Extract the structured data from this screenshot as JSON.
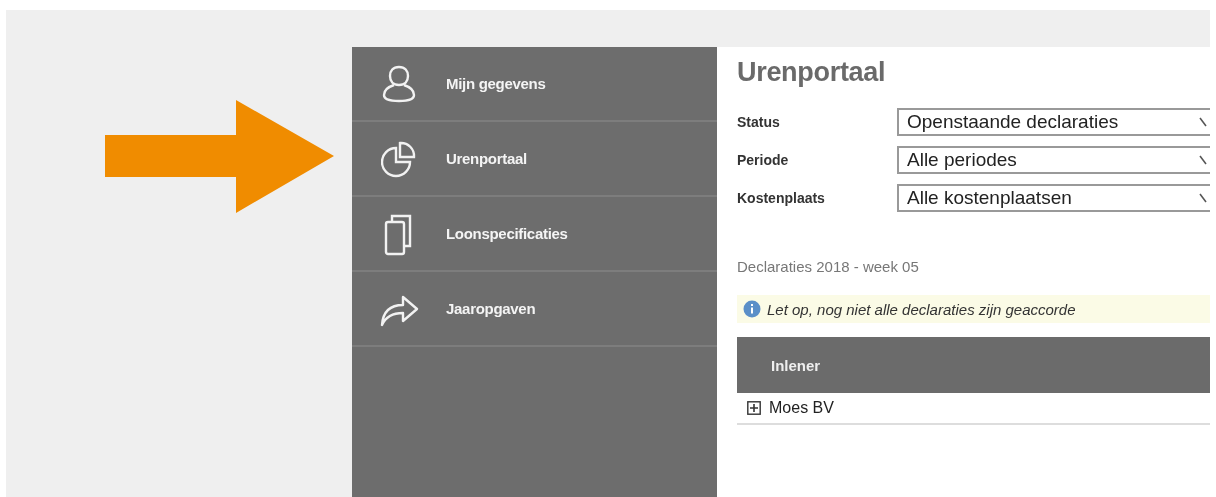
{
  "sidebar": {
    "items": [
      {
        "label": "Mijn gegevens",
        "kind": "person"
      },
      {
        "label": "Urenportaal",
        "kind": "chart"
      },
      {
        "label": "Loonspecificaties",
        "kind": "pages"
      },
      {
        "label": "Jaaropgaven",
        "kind": "share"
      }
    ]
  },
  "content": {
    "title": "Urenportaal",
    "filters": [
      {
        "label": "Status",
        "value": "Openstaande declaraties"
      },
      {
        "label": "Periode",
        "value": "Alle periodes"
      },
      {
        "label": "Kostenplaats",
        "value": "Alle kostenplaatsen"
      }
    ],
    "section_title": "Declaraties 2018 - week 05",
    "notice": "Let op, nog niet alle declaraties zijn geaccorde",
    "table": {
      "columns": [
        "Inlener"
      ],
      "rows": [
        {
          "label": "Moes BV",
          "expanded": false
        }
      ]
    }
  }
}
